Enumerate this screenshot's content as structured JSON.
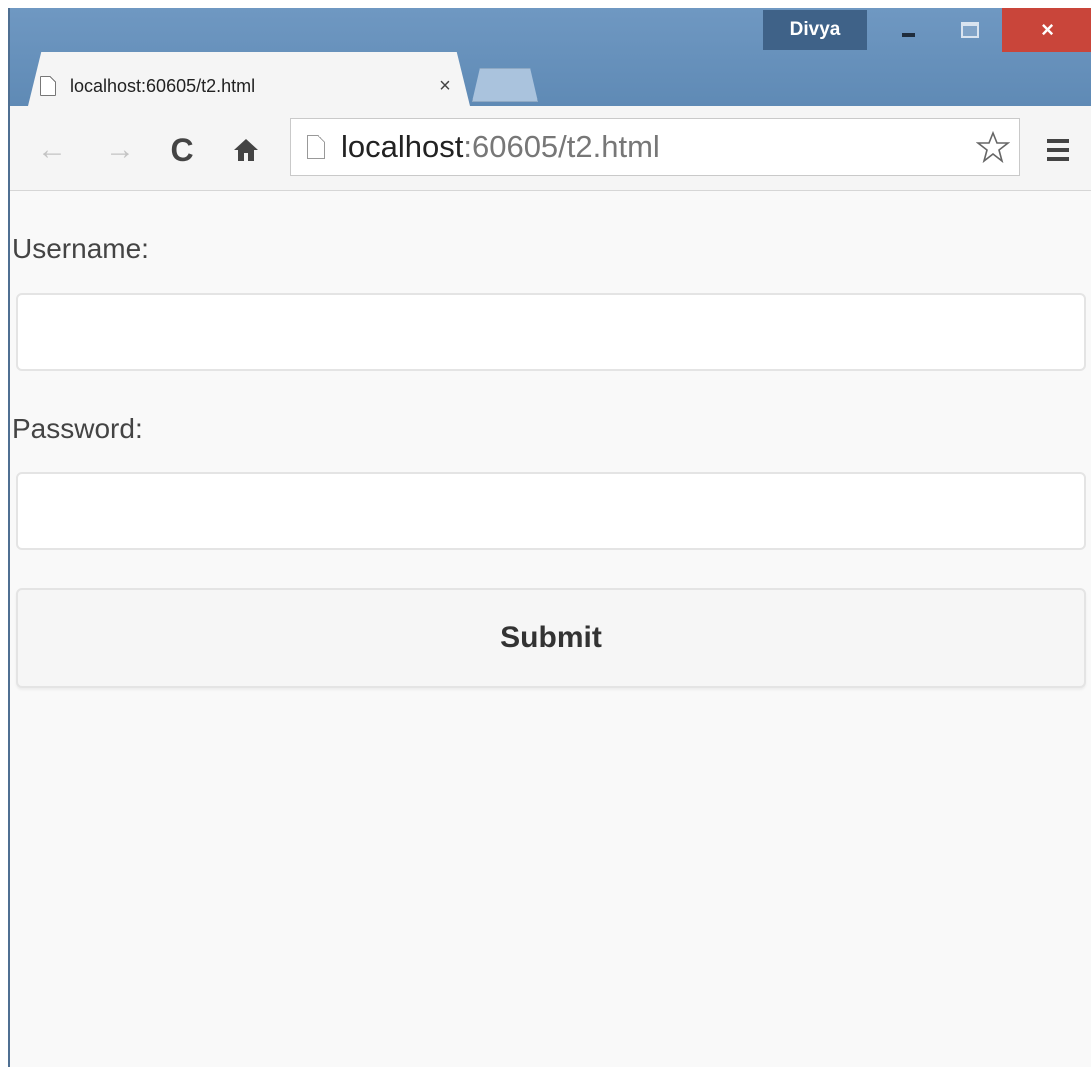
{
  "window": {
    "user_name": "Divya",
    "minimize_icon": "minimize-icon",
    "maximize_icon": "maximize-icon",
    "close_glyph": "×"
  },
  "tabs": [
    {
      "title": "localhost:60605/t2.html",
      "close_glyph": "×",
      "icon": "page-icon"
    }
  ],
  "toolbar": {
    "back_glyph": "←",
    "forward_glyph": "→",
    "reload_glyph": "C",
    "home_glyph": "⌂",
    "url_host": "localhost",
    "url_rest": ":60605/t2.html",
    "bookmark_icon": "star-icon",
    "menu_icon": "hamburger-menu-icon"
  },
  "form": {
    "username_label": "Username:",
    "username_value": "",
    "password_label": "Password:",
    "password_value": "",
    "submit_label": "Submit"
  },
  "colors": {
    "titlebar": "#6a93bd",
    "close_button": "#c9453a",
    "user_badge": "#3f6288",
    "page_background": "#f9f9f9"
  }
}
